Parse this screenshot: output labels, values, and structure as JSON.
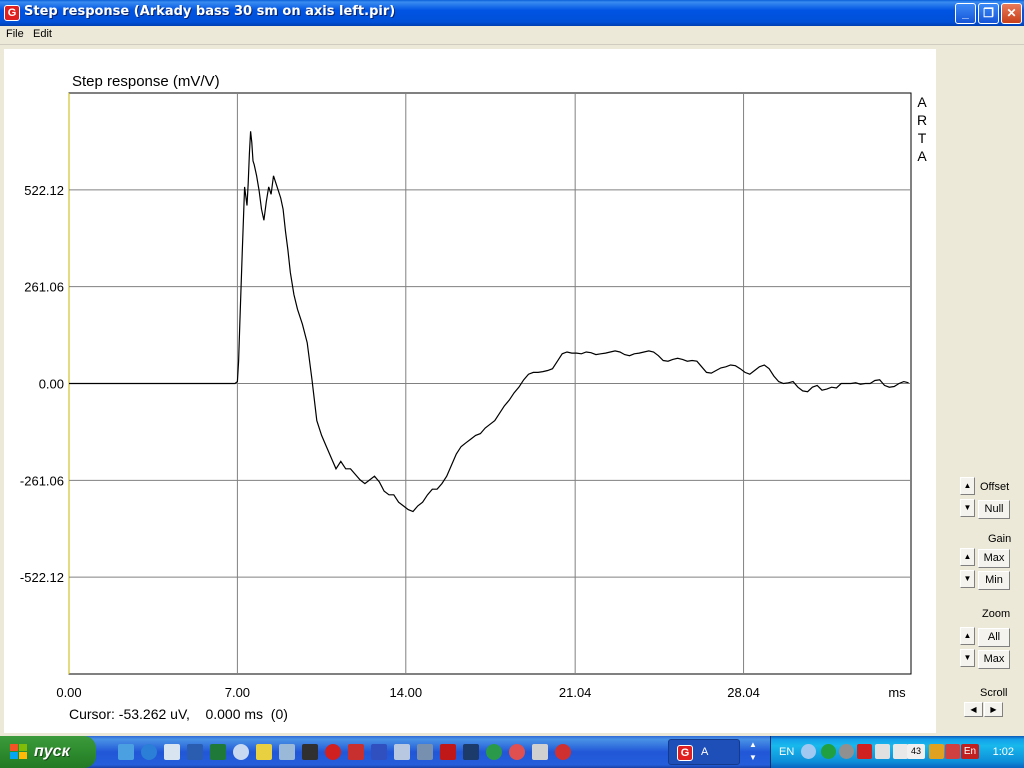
{
  "window": {
    "title": "Step response (Arkady bass 30 sm on axis left.pir)",
    "app_icon_letter": "G"
  },
  "menu": {
    "items": [
      "File",
      "Edit"
    ]
  },
  "plot": {
    "side_watermark": [
      "A",
      "R",
      "T",
      "A"
    ],
    "cursor_readout": "Cursor: -53.262 uV,    0.000 ms  (0)"
  },
  "chart_data": {
    "type": "line",
    "title": "Step response (mV/V)",
    "xlabel": "ms",
    "ylabel": "",
    "xlim": [
      0,
      35.0
    ],
    "ylim": [
      -783.18,
      783.18
    ],
    "x_ticks": [
      "0.00",
      "7.00",
      "14.00",
      "21.04",
      "28.04"
    ],
    "y_ticks": [
      "522.12",
      "261.06",
      "0.00",
      "-261.06",
      "-522.12"
    ],
    "grid": true,
    "series": [
      {
        "x": [
          0,
          2,
          4,
          6,
          6.9,
          7.0,
          7.05,
          7.1,
          7.2,
          7.3,
          7.4,
          7.45,
          7.5,
          7.55,
          7.6,
          7.65,
          7.7,
          7.8,
          7.9,
          8.0,
          8.1,
          8.2,
          8.3,
          8.4,
          8.5,
          8.6,
          8.7,
          8.8,
          8.9,
          9.0,
          9.1,
          9.2,
          9.35,
          9.5,
          9.7,
          9.9,
          10.1,
          10.3,
          10.5,
          10.7,
          10.9,
          11.1,
          11.3,
          11.5,
          11.7,
          11.9,
          12.1,
          12.3,
          12.5,
          12.7,
          12.9,
          13.1,
          13.3,
          13.5,
          13.7,
          13.9,
          14.1,
          14.3,
          14.5,
          14.7,
          14.9,
          15.1,
          15.3,
          15.5,
          15.7,
          15.9,
          16.1,
          16.3,
          16.5,
          16.7,
          16.9,
          17.1,
          17.3,
          17.5,
          17.7,
          17.9,
          18.1,
          18.3,
          18.5,
          18.7,
          18.9,
          19.1,
          19.3,
          19.5,
          19.7,
          19.9,
          20.1,
          20.3,
          20.5,
          20.7,
          20.9,
          21.1,
          21.3,
          21.5,
          21.7,
          21.9,
          22.1,
          22.3,
          22.5,
          22.7,
          22.9,
          23.1,
          23.3,
          23.5,
          23.7,
          23.9,
          24.1,
          24.3,
          24.5,
          24.7,
          24.9,
          25.1,
          25.3,
          25.5,
          25.7,
          25.9,
          26.1,
          26.3,
          26.5,
          26.7,
          26.9,
          27.1,
          27.3,
          27.5,
          27.7,
          27.9,
          28.1,
          28.3,
          28.5,
          28.7,
          28.9,
          29.1,
          29.3,
          29.5,
          29.7,
          29.9,
          30.1,
          30.3,
          30.5,
          30.7,
          30.9,
          31.1,
          31.3,
          31.5,
          31.7,
          31.9,
          32.1,
          32.3,
          32.5,
          32.7,
          32.9,
          33.1,
          33.3,
          33.5,
          33.7,
          33.9,
          34.1,
          34.3,
          34.5,
          34.7,
          34.9
        ],
        "values": [
          0,
          0,
          0,
          0,
          0,
          5,
          60,
          160,
          350,
          530,
          480,
          540,
          620,
          680,
          650,
          600,
          590,
          560,
          520,
          470,
          440,
          490,
          530,
          510,
          560,
          540,
          520,
          500,
          470,
          410,
          360,
          300,
          240,
          200,
          160,
          110,
          10,
          -100,
          -140,
          -170,
          -200,
          -230,
          -210,
          -230,
          -230,
          -245,
          -260,
          -270,
          -260,
          -250,
          -265,
          -290,
          -300,
          -300,
          -320,
          -330,
          -340,
          -345,
          -330,
          -320,
          -300,
          -285,
          -285,
          -270,
          -250,
          -220,
          -190,
          -170,
          -160,
          -150,
          -140,
          -135,
          -120,
          -110,
          -100,
          -80,
          -60,
          -45,
          -25,
          -10,
          10,
          25,
          30,
          30,
          32,
          35,
          40,
          60,
          80,
          85,
          82,
          82,
          80,
          85,
          83,
          78,
          80,
          82,
          85,
          88,
          85,
          78,
          75,
          80,
          82,
          85,
          88,
          85,
          75,
          62,
          60,
          65,
          68,
          65,
          60,
          62,
          60,
          45,
          30,
          28,
          35,
          42,
          45,
          50,
          48,
          40,
          30,
          25,
          35,
          45,
          50,
          40,
          20,
          5,
          0,
          2,
          5,
          -10,
          -20,
          -22,
          -10,
          -5,
          -18,
          -15,
          -10,
          -12,
          0,
          0,
          0,
          2,
          -2,
          0,
          0,
          8,
          10,
          -5,
          -10,
          -8,
          0,
          5,
          2
        ]
      }
    ]
  },
  "controls": {
    "offset": {
      "label": "Offset",
      "button": "Null"
    },
    "gain": {
      "label": "Gain",
      "button_top": "Max",
      "button_bottom": "Min"
    },
    "zoom": {
      "label": "Zoom",
      "button_top": "All",
      "button_bottom": "Max"
    },
    "scroll": {
      "label": "Scroll"
    }
  },
  "taskbar": {
    "start_label": "пуск",
    "task_label": "A",
    "language": "EN",
    "tray_lang": "En",
    "tray_count": "43",
    "clock": "1:02"
  }
}
